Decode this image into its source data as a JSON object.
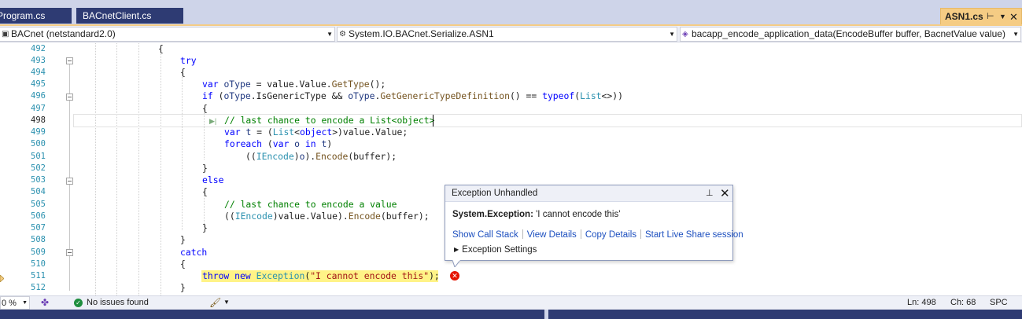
{
  "tabs": {
    "program": "Program.cs",
    "bacnet_client": "BACnetClient.cs",
    "active": "ASN1.cs"
  },
  "navbar": {
    "project": "BACnet (netstandard2.0)",
    "type": "System.IO.BACnet.Serialize.ASN1",
    "member": "bacapp_encode_application_data(EncodeBuffer buffer, BacnetValue value)"
  },
  "editor": {
    "current_line": "498",
    "line_numbers": [
      "492",
      "493",
      "494",
      "495",
      "496",
      "497",
      "498",
      "499",
      "500",
      "501",
      "502",
      "503",
      "504",
      "505",
      "506",
      "507",
      "508",
      "509",
      "510",
      "511",
      "512"
    ],
    "code": {
      "l492": "{",
      "l493_kw": "try",
      "l494": "{",
      "l495_kw": "var",
      "l495_var": "oType",
      "l495_mid": " = value.Value.",
      "l495_me": "GetType",
      "l495_end": "();",
      "l496_kw": "if",
      "l496_a": " (",
      "l496_var1": "oType",
      "l496_b": ".IsGenericType && ",
      "l496_var2": "oType",
      "l496_c": ".",
      "l496_me": "GetGenericTypeDefinition",
      "l496_d": "() == ",
      "l496_kw2": "typeof",
      "l496_e": "(",
      "l496_ty": "List",
      "l496_f": "<>))",
      "l497": "{",
      "l498_cm": "// last chance to encode a List<object>",
      "l499_kw": "var",
      "l499_var": "t",
      "l499_a": " = (",
      "l499_ty": "List",
      "l499_b": "<",
      "l499_kw2": "object",
      "l499_c": ">)value.Value;",
      "l500_kw": "foreach",
      "l500_a": " (",
      "l500_kw2": "var",
      "l500_var": "o",
      "l500_kw3": "in",
      "l500_var2": "t",
      "l500_b": ")",
      "l501_a": "((",
      "l501_ty": "IEncode",
      "l501_b": ")",
      "l501_var": "o",
      "l501_c": ").",
      "l501_me": "Encode",
      "l501_d": "(buffer);",
      "l502": "}",
      "l503_kw": "else",
      "l504": "{",
      "l505_cm": "// last chance to encode a value",
      "l506_a": "((",
      "l506_ty": "IEncode",
      "l506_b": ")value.Value).",
      "l506_me": "Encode",
      "l506_c": "(buffer);",
      "l507": "}",
      "l508": "}",
      "l509_kw": "catch",
      "l510": "{",
      "l511_kw": "throw new",
      "l511_ty": "Exception",
      "l511_a": "(",
      "l511_st": "\"I cannot encode this\"",
      "l511_b": ");",
      "l512": "}"
    }
  },
  "exception_popup": {
    "title": "Exception Unhandled",
    "exception_type": "System.Exception:",
    "message": "'I cannot encode this'",
    "links": [
      "Show Call Stack",
      "View Details",
      "Copy Details",
      "Start Live Share session"
    ],
    "settings": "Exception Settings"
  },
  "statusbar": {
    "zoom": "0 %",
    "issues": "No issues found",
    "line": "Ln: 498",
    "col": "Ch: 68",
    "whitespace": "SPC"
  },
  "colors": {
    "tab_inactive": "#2e3b73",
    "tab_active": "#f5cc84",
    "highlight_throw": "#fff387",
    "keyword": "#0000ff",
    "type": "#2b91af",
    "comment": "#008000",
    "string": "#a31515",
    "link": "#1c4fbf",
    "error": "#e51400"
  },
  "icons": {
    "pin": "pin-icon",
    "close": "close-icon",
    "error": "error-icon",
    "ok": "check-circle-icon",
    "expand": "expand-triangle-icon"
  }
}
